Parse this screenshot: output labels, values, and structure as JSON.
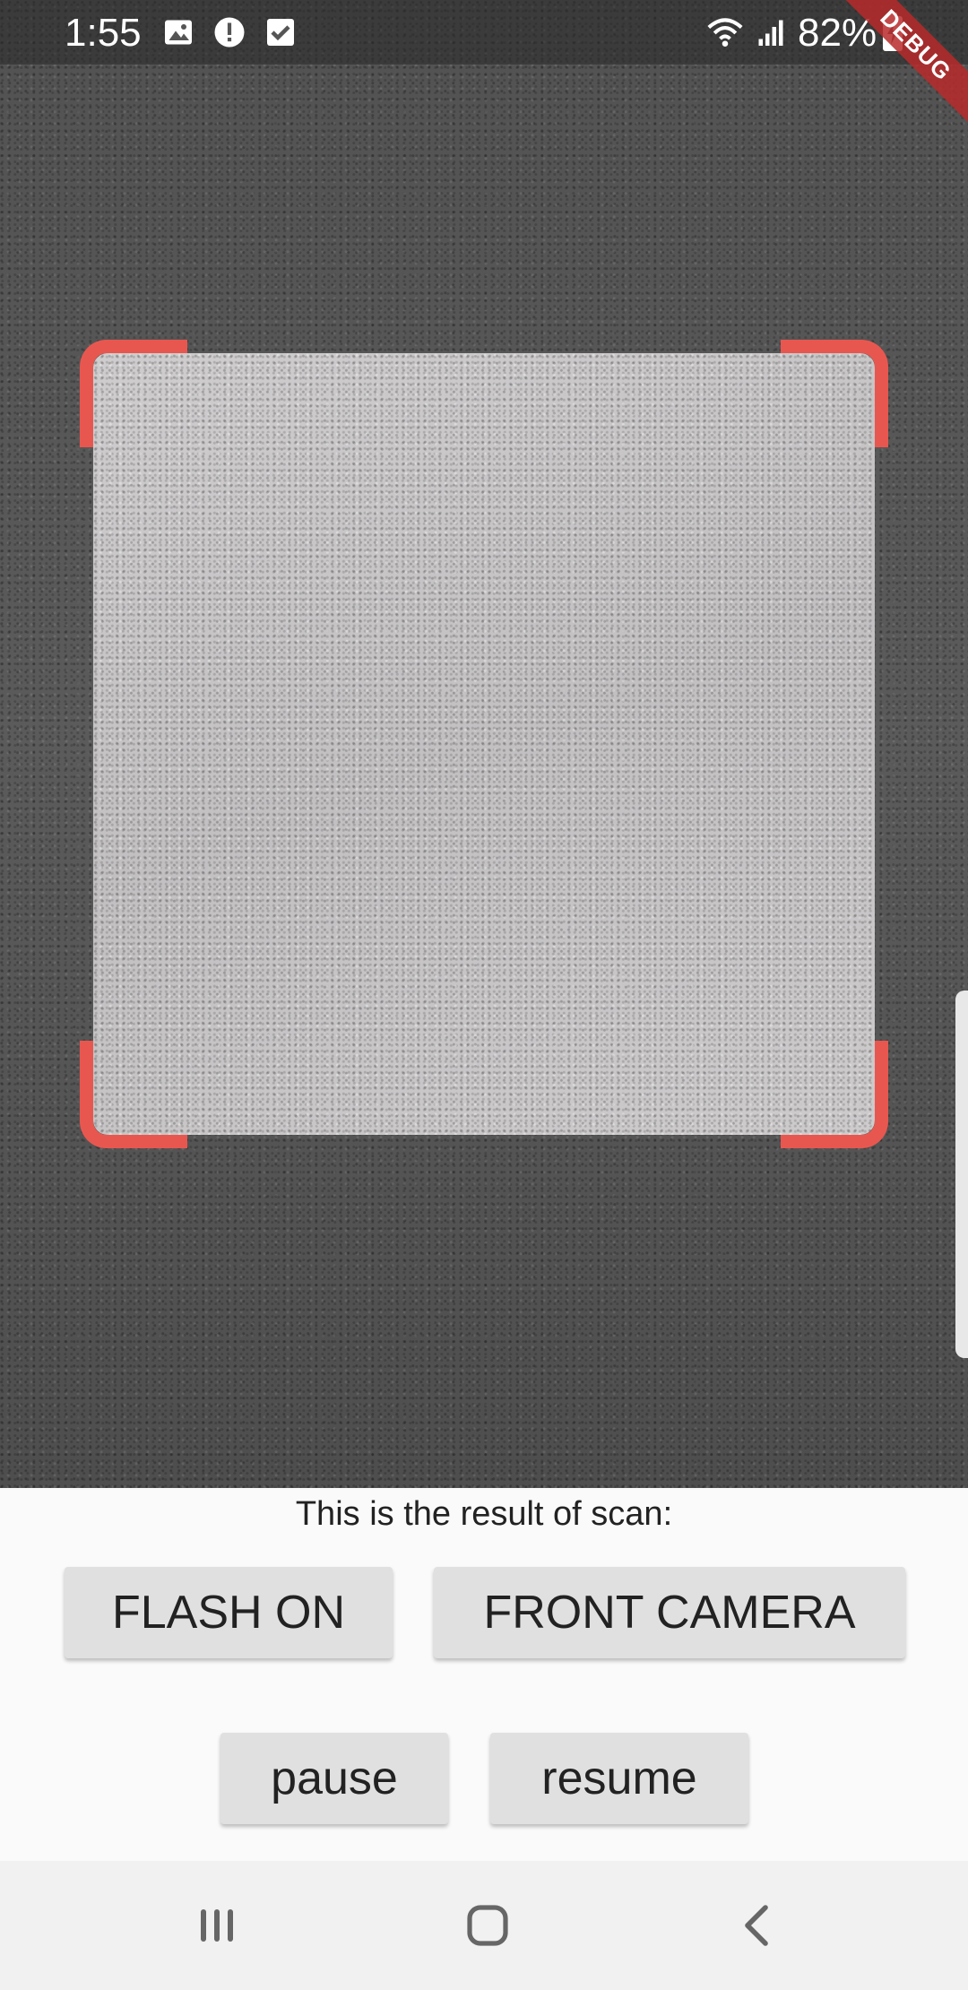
{
  "status_bar": {
    "time": "1:55",
    "battery": "82%",
    "icons": [
      "image-icon",
      "alert-icon",
      "checkbox-icon",
      "wifi-icon",
      "signal-icon",
      "battery-charging-icon"
    ]
  },
  "debug_banner": "DEBUG",
  "scanner": {
    "overlay_color": "#e8574f"
  },
  "result": {
    "text": "This is the result of scan:"
  },
  "buttons": {
    "flash": "FLASH ON",
    "front_camera": "FRONT CAMERA",
    "pause": "pause",
    "resume": "resume"
  },
  "nav_bar": {
    "icons": [
      "recents-icon",
      "home-icon",
      "back-icon"
    ]
  }
}
